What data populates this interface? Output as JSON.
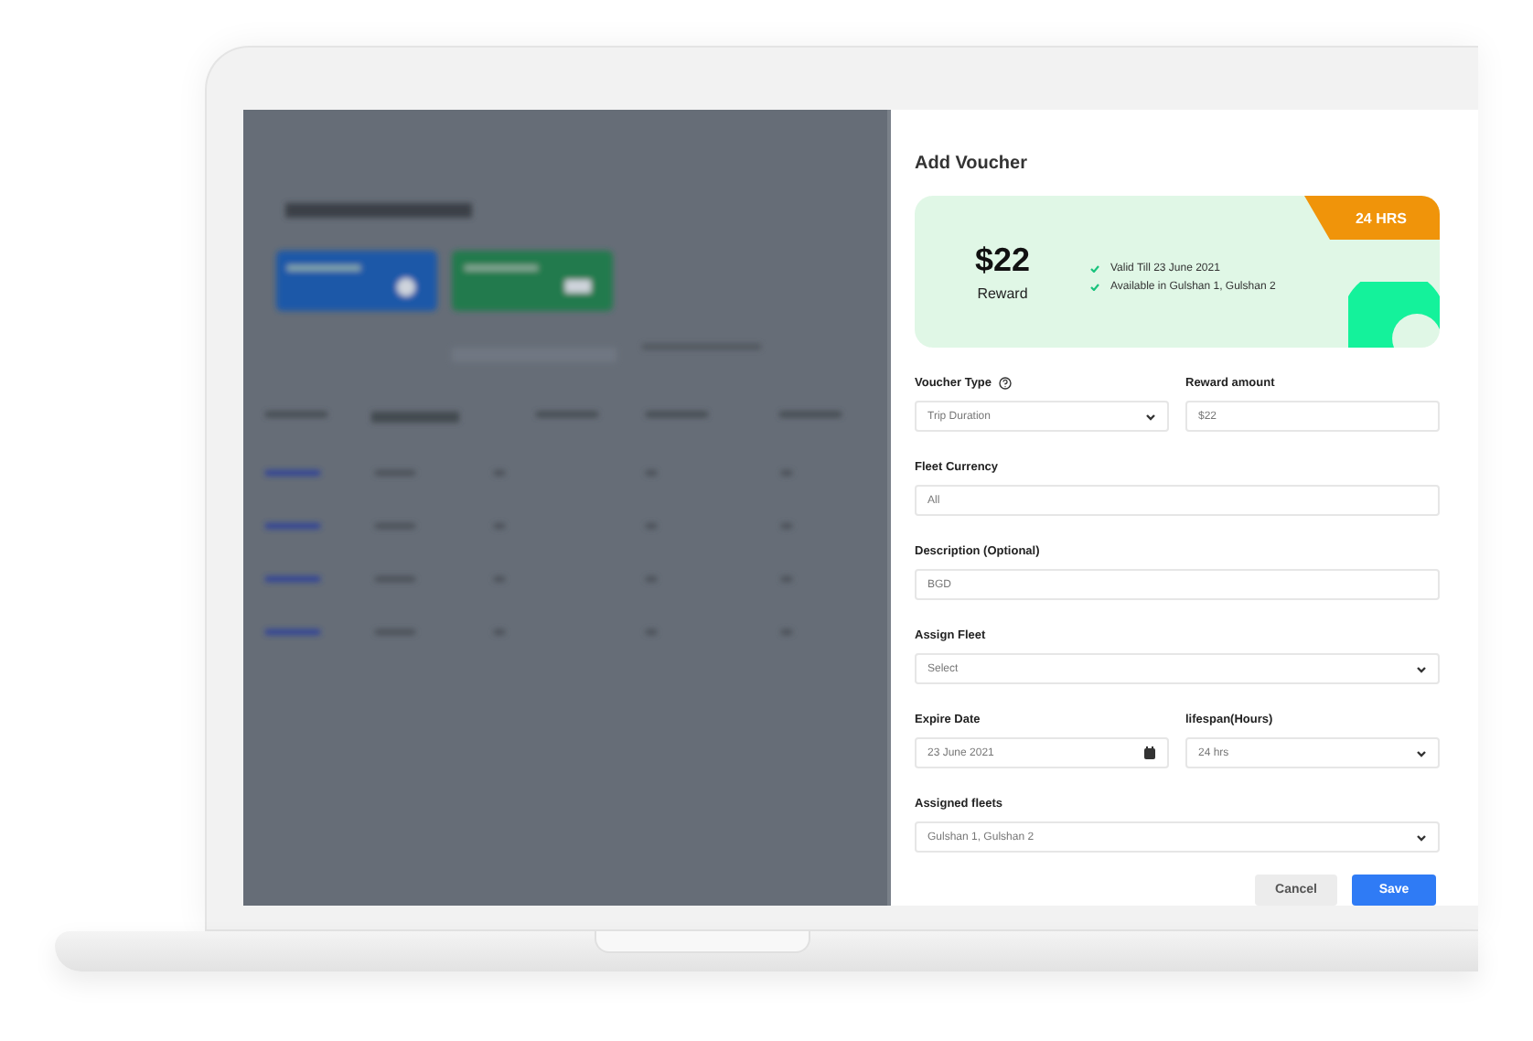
{
  "drawer": {
    "title": "Add Voucher",
    "voucher_card": {
      "amount": "$22",
      "amount_label": "Reward",
      "badge": "24 HRS",
      "perks": [
        "Valid Till 23 June 2021",
        "Available in Gulshan 1, Gulshan 2"
      ]
    },
    "form_rows": [
      [
        {
          "label": "Voucher Type",
          "kind": "select",
          "value": "Trip Duration",
          "help": true
        },
        {
          "label": "Reward amount",
          "kind": "text",
          "value": "$22",
          "help": false
        }
      ],
      [
        {
          "label": "Fleet Currency",
          "kind": "text",
          "value": "All",
          "help": false
        }
      ],
      [
        {
          "label": "Description (Optional)",
          "kind": "text",
          "value": "BGD",
          "help": false
        }
      ],
      [
        {
          "label": "Assign Fleet",
          "kind": "select",
          "value": "Select",
          "help": false
        }
      ],
      [
        {
          "label": "Expire Date",
          "kind": "date",
          "value": "23 June 2021",
          "help": false
        },
        {
          "label": "lifespan(Hours)",
          "kind": "select",
          "value": "24 hrs",
          "help": false
        }
      ],
      [
        {
          "label": "Assigned fleets",
          "kind": "select",
          "value": "Gulshan 1, Gulshan 2",
          "help": false
        }
      ]
    ],
    "buttons": [
      {
        "label": "Cancel",
        "kind": "secondary"
      },
      {
        "label": "Save",
        "kind": "primary"
      }
    ]
  }
}
